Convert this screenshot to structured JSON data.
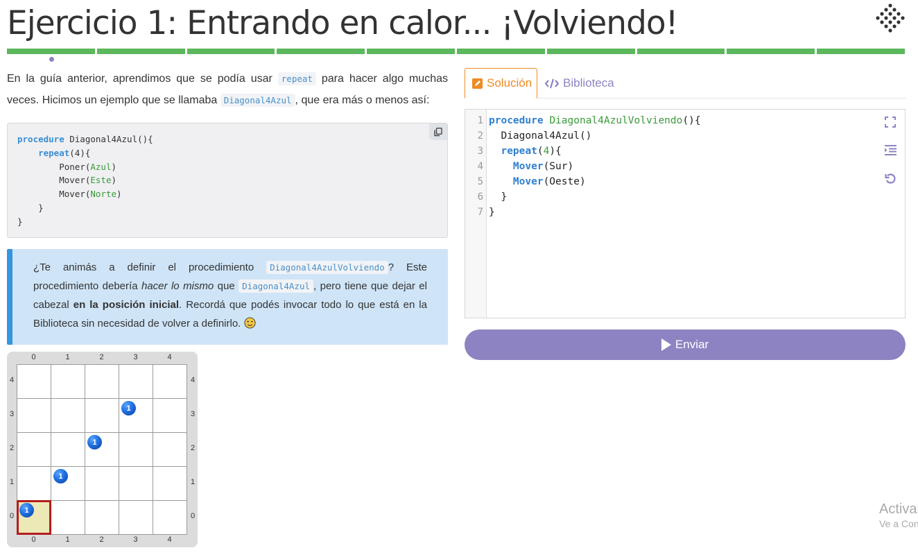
{
  "title": "Ejercicio 1: Entrando en calor... ¡Volviendo!",
  "colors": {
    "progress": "#5cb85c",
    "accent_purple": "#8e83c2",
    "tab_active": "#f08a24",
    "info_bg": "#cfe4f7",
    "info_border": "#3596de"
  },
  "progress": {
    "segments": 10,
    "completed": 10,
    "current_index": 0
  },
  "intro": {
    "t1": "En la guía anterior, aprendimos que se podía usar ",
    "code1": "repeat",
    "t2": " para hacer algo muchas veces. Hicimos un ejemplo que se llamaba ",
    "code2": "Diagonal4Azul",
    "t3": ", que era más o menos así:"
  },
  "example_code": {
    "copy_icon": "copy-icon",
    "l1_kw": "procedure",
    "l1_rest": " Diagonal4Azul(){",
    "l2_kw": "repeat",
    "l2_rest": "(4){",
    "l3_fn": "Poner(",
    "l3_arg": "Azul",
    "l3_end": ")",
    "l4_fn": "Mover(",
    "l4_arg": "Este",
    "l4_end": ")",
    "l5_fn": "Mover(",
    "l5_arg": "Norte",
    "l5_end": ")",
    "l6": "}",
    "l7": "}"
  },
  "info": {
    "t1": "¿Te animás a definir el procedimiento ",
    "code1": "Diagonal4AzulVolviendo",
    "t2": "? Este procedimiento debería ",
    "em1": "hacer lo mismo",
    "t3": " que ",
    "code2": "Diagonal4Azul",
    "t4": ", pero tiene que dejar el cabezal ",
    "strong1": "en la posición inicial",
    "t5": ". Recordá que podés invocar todo lo que está en la Biblioteca sin necesidad de volver a definirlo.",
    "emoji_icon": "wink-emoji-icon"
  },
  "board": {
    "columns": [
      "0",
      "1",
      "2",
      "3",
      "4"
    ],
    "rows": [
      "4",
      "3",
      "2",
      "1",
      "0"
    ],
    "balls": [
      {
        "col": 0,
        "row": 0,
        "count": "1",
        "color": "azul"
      },
      {
        "col": 1,
        "row": 1,
        "count": "1",
        "color": "azul"
      },
      {
        "col": 2,
        "row": 2,
        "count": "1",
        "color": "azul"
      },
      {
        "col": 3,
        "row": 3,
        "count": "1",
        "color": "azul"
      }
    ],
    "head": {
      "col": 0,
      "row": 0
    }
  },
  "tabs": {
    "solution": "Solución",
    "library": "Biblioteca"
  },
  "editor": {
    "line_numbers": [
      "1",
      "2",
      "3",
      "4",
      "5",
      "6",
      "7"
    ],
    "l1_kw": "procedure",
    "l1_fn": "Diagonal4AzulVolviendo",
    "l1_end": "(){",
    "l2": "  Diagonal4Azul()",
    "l3_kw": "repeat",
    "l3_num": "4",
    "l3_pre": "  ",
    "l3_open": "(",
    "l3_end": "){",
    "l4_pre": "    ",
    "l4_kw": "Mover",
    "l4_end": "(Sur)",
    "l5_pre": "    ",
    "l5_kw": "Mover",
    "l5_end": "(Oeste)",
    "l6": "  }",
    "l7": "}",
    "tools": [
      "fullscreen-icon",
      "indent-icon",
      "reset-icon"
    ]
  },
  "submit": {
    "label": "Enviar"
  },
  "watermark": {
    "line1": "Activar",
    "line2": "Ve a Configuración"
  }
}
